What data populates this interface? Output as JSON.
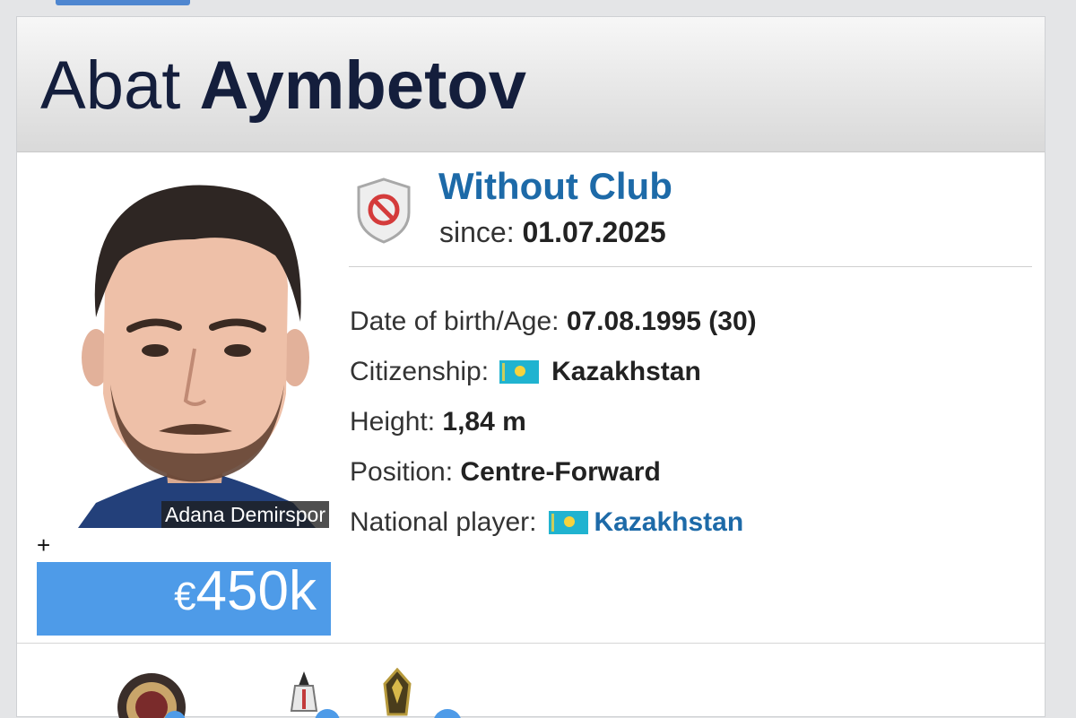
{
  "player": {
    "first_name": "Abat",
    "last_name": "Aymbetov",
    "photo_caption": "Adana Demirspor"
  },
  "club": {
    "name": "Without Club",
    "since_label": "since:",
    "since_date": "01.07.2025",
    "icon": "no-club-icon"
  },
  "market_value": {
    "plus": "+",
    "currency": "€",
    "amount": "450k"
  },
  "info": {
    "dob_label": "Date of birth/Age:",
    "dob_value": "07.08.1995 (30)",
    "citizenship_label": "Citizenship:",
    "citizenship_value": "Kazakhstan",
    "height_label": "Height:",
    "height_value": "1,84 m",
    "position_label": "Position:",
    "position_value": "Centre-Forward",
    "national_label": "National player:",
    "national_value": "Kazakhstan"
  },
  "colors": {
    "accent_blue": "#1d6aa8",
    "value_box": "#4e9be8",
    "name_color": "#141e3c",
    "flag_kz": "#20b3d0"
  }
}
